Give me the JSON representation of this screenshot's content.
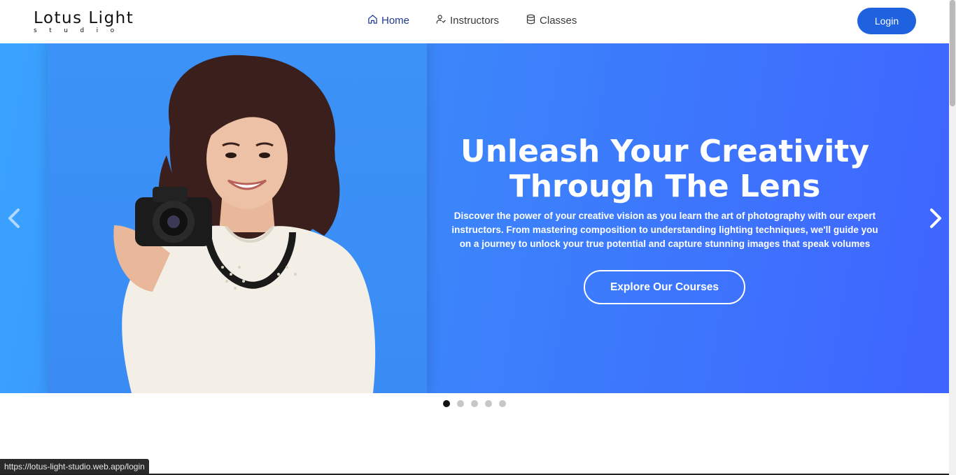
{
  "brand": {
    "name": "Lotus Light",
    "tagline": "studio"
  },
  "nav": {
    "items": [
      {
        "label": "Home",
        "icon": "home-icon",
        "active": true
      },
      {
        "label": "Instructors",
        "icon": "user-check-icon",
        "active": false
      },
      {
        "label": "Classes",
        "icon": "database-icon",
        "active": false
      }
    ],
    "login_label": "Login"
  },
  "hero": {
    "title": "Unleash Your Creativity Through The Lens",
    "description": "Discover the power of your creative vision as you learn the art of photography with our expert instructors. From mastering composition to understanding lighting techniques, we'll guide you on a journey to unlock your true potential and capture stunning images that speak volumes",
    "cta_label": "Explore Our Courses",
    "slide_count": 5,
    "active_slide": 1
  },
  "status_bar": {
    "url": "https://lotus-light-studio.web.app/login"
  },
  "colors": {
    "accent": "#1f62e0",
    "hero_start": "#3aa3ff",
    "hero_end": "#3f64ff"
  }
}
